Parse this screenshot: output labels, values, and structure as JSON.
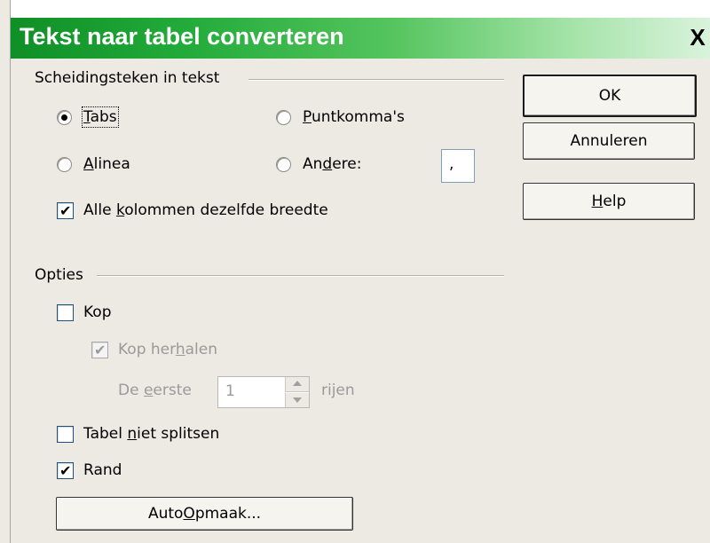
{
  "window": {
    "title": "Tekst naar tabel converteren",
    "close_glyph": "X"
  },
  "separator_group": {
    "label": "Scheidingsteken in tekst",
    "options": [
      {
        "pre": "",
        "ul": "T",
        "post": "abs",
        "checked": true
      },
      {
        "pre": "",
        "ul": "P",
        "post": "untkomma's",
        "checked": false
      },
      {
        "pre": "",
        "ul": "A",
        "post": "linea",
        "checked": false
      },
      {
        "pre": "An",
        "ul": "d",
        "post": "ere:",
        "checked": false
      }
    ],
    "other_value": ",",
    "equal_width": {
      "pre": "Alle ",
      "ul": "k",
      "post": "olommen dezelfde breedte",
      "checked": true
    }
  },
  "options_group": {
    "label": "Opties",
    "header": {
      "label": "Kop",
      "checked": false
    },
    "repeat_header": {
      "pre": "Kop her",
      "ul": "h",
      "post": "alen",
      "checked": true
    },
    "first_rows": {
      "pre": "De ",
      "ul": "e",
      "post": "erste",
      "value": "1",
      "suffix": "rijen"
    },
    "dont_split": {
      "pre": "Tabel ",
      "ul": "n",
      "post": "iet splitsen",
      "checked": false
    },
    "border": {
      "label": "Rand",
      "checked": true
    },
    "autoformat": {
      "pre": "Auto",
      "ul": "O",
      "post": "pmaak..."
    }
  },
  "buttons": {
    "ok": "OK",
    "cancel": "Annuleren",
    "help": {
      "pre": "",
      "ul": "H",
      "post": "elp"
    }
  }
}
